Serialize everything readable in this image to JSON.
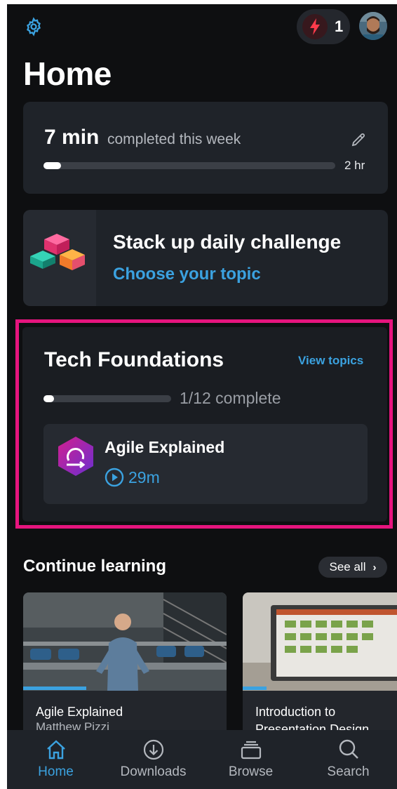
{
  "header": {
    "streak_count": "1",
    "streak_icon": "lightning-bolt-icon",
    "settings_icon": "gear-icon"
  },
  "page": {
    "title": "Home"
  },
  "weekly_goal": {
    "minutes": "7 min",
    "label": "completed this week",
    "goal": "2 hr",
    "progress_fraction": 0.06
  },
  "daily_challenge": {
    "title": "Stack up daily challenge",
    "link": "Choose your topic"
  },
  "path": {
    "title": "Tech Foundations",
    "view_topics": "View topics",
    "progress_text": "1/12 complete",
    "progress_fraction": 0.083,
    "course": {
      "name": "Agile Explained",
      "duration": "29m"
    }
  },
  "continue_learning": {
    "title": "Continue learning",
    "see_all": "See all",
    "items": [
      {
        "title": "Agile Explained",
        "author": "Matthew Pizzi",
        "progress_fraction": 0.31
      },
      {
        "title": "Introduction to",
        "title2": "Presentation Design",
        "progress_fraction": 0.14
      }
    ]
  },
  "tabs": [
    {
      "label": "Home",
      "icon": "home-icon",
      "active": true
    },
    {
      "label": "Downloads",
      "icon": "download-icon",
      "active": false
    },
    {
      "label": "Browse",
      "icon": "browse-stack-icon",
      "active": false
    },
    {
      "label": "Search",
      "icon": "search-icon",
      "active": false
    }
  ],
  "colors": {
    "accent": "#3ba2e0",
    "highlight": "#e6157e",
    "streak": "#ff3b4b"
  }
}
